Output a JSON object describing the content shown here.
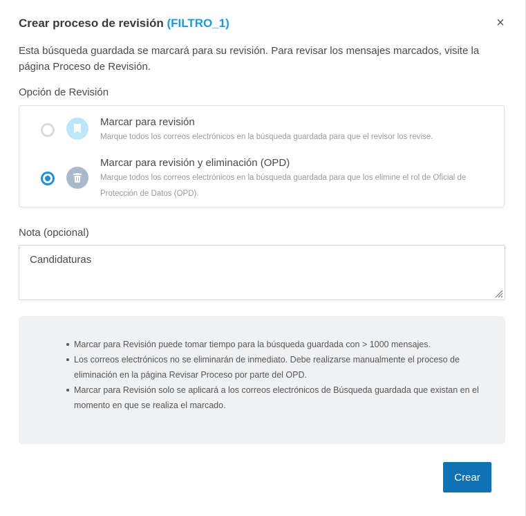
{
  "dialog": {
    "title": "Crear proceso de revisión",
    "title_filter": "(FILTRO_1)",
    "close_label": "×",
    "intro": "Esta búsqueda guardada se marcará para su revisión. Para revisar los mensajes marcados, visite la página Proceso de Revisión."
  },
  "review_option": {
    "label": "Opción de Revisión",
    "options": [
      {
        "title": "Marcar para revisión",
        "description": "Marque todos los correos electrónicos en la búsqueda guardada para que el revisor los revise.",
        "selected": false,
        "icon": "bookmark-icon"
      },
      {
        "title": "Marcar para revisión y eliminación (OPD)",
        "description": "Marque todos los correos electrónicos en la búsqueda guardada para que los elimine el rol de Oficial de Protección de Datos (OPD).",
        "selected": true,
        "icon": "trash-icon"
      }
    ]
  },
  "note": {
    "label": "Nota (opcional)",
    "value": "Candidaturas"
  },
  "info": {
    "items": [
      "Marcar para Revisión puede tomar tiempo para la búsqueda guardada con > 1000 mensajes.",
      "Los correos electrónicos no se eliminarán de inmediato. Debe realizarse manualmente el proceso de eliminación en la página Revisar Proceso por parte del OPD.",
      "Marcar para Revisión solo se aplicará a los correos electrónicos de Búsqueda guardada que existan en el momento en que se realiza el marcado."
    ]
  },
  "actions": {
    "create_label": "Crear"
  },
  "colors": {
    "accent": "#1f9bd1",
    "primary_button": "#0f72b5",
    "radio_selected": "#1f8fd8"
  }
}
